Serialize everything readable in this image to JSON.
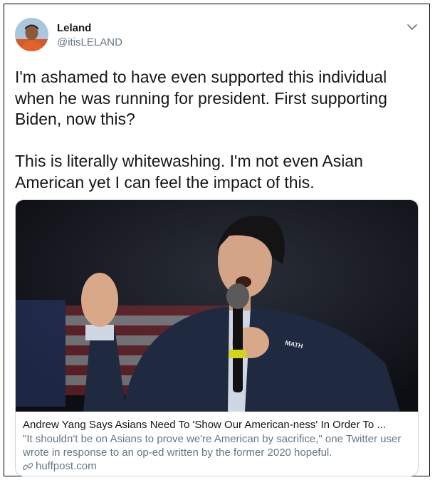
{
  "author": {
    "name": "Leland",
    "handle": "@itisLELAND"
  },
  "icons": {
    "menu": "chevron-down-icon",
    "avatar": "avatar",
    "link": "link-icon"
  },
  "tweet": {
    "text": "I'm ashamed to have even supported this individual when he was running for president. First supporting Biden, now this?\n\nThis is literally whitewashing. I'm not even Asian American yet I can feel the impact of this."
  },
  "card": {
    "title": "Andrew Yang Says Asians Need To 'Show Our American-ness' In Order To ...",
    "description": "\"It shouldn't be on Asians to prove we're American by sacrifice,\" one Twitter user wrote in response to an op-ed written by the former 2020 hopeful.",
    "domain": "huffpost.com",
    "image_badge": "MATH"
  },
  "colors": {
    "text": "#14171a",
    "secondary": "#657786",
    "border": "#ccd6dd"
  }
}
